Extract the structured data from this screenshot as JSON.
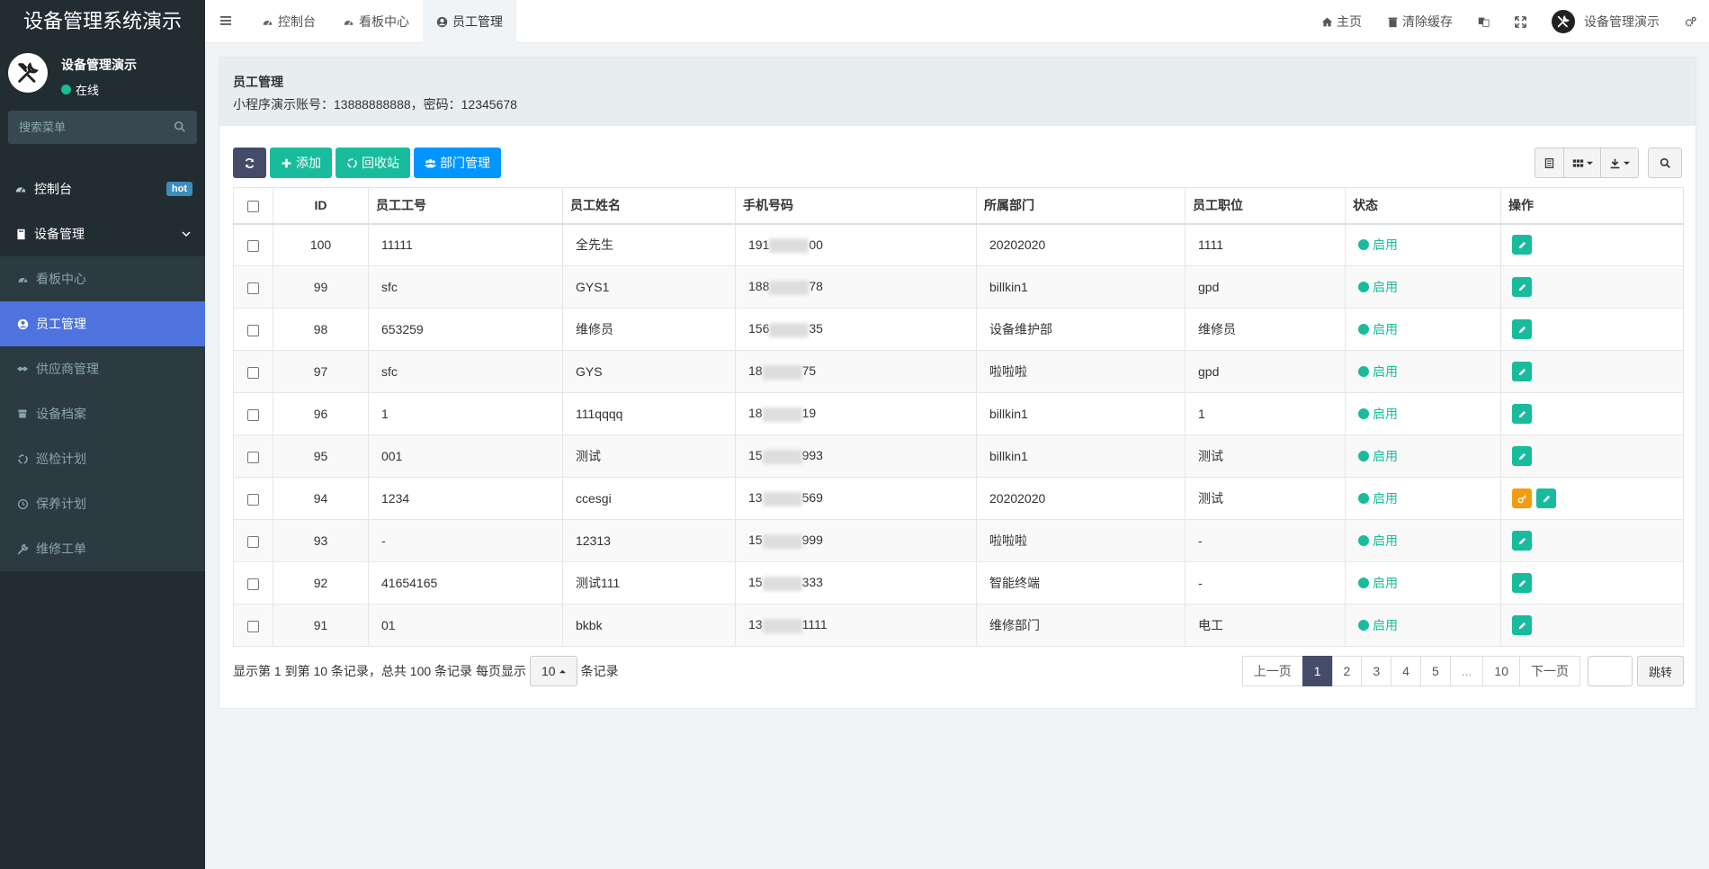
{
  "app": {
    "brand": "设备管理系统演示"
  },
  "user": {
    "name": "设备管理演示",
    "status": "在线"
  },
  "sidebar": {
    "search_placeholder": "搜索菜单",
    "items": [
      {
        "label": "控制台",
        "badge": "hot",
        "icon": "dashboard-icon"
      },
      {
        "label": "设备管理",
        "icon": "book-icon"
      },
      {
        "label": "看板中心",
        "icon": "dashboard-icon"
      },
      {
        "label": "员工管理",
        "icon": "user-circle-icon"
      },
      {
        "label": "供应商管理",
        "icon": "handshake-icon"
      },
      {
        "label": "设备档案",
        "icon": "archive-icon"
      },
      {
        "label": "巡检计划",
        "icon": "recycle-icon"
      },
      {
        "label": "保养计划",
        "icon": "clock-icon"
      },
      {
        "label": "维修工单",
        "icon": "wrench-icon"
      }
    ]
  },
  "navbar": {
    "tabs": [
      {
        "label": "控制台"
      },
      {
        "label": "看板中心"
      },
      {
        "label": "员工管理"
      }
    ],
    "home": "主页",
    "clear_cache": "清除缓存",
    "user": "设备管理演示"
  },
  "panel": {
    "title": "员工管理",
    "desc": "小程序演示账号：13888888888，密码：12345678"
  },
  "toolbar": {
    "add": "添加",
    "recycle": "回收站",
    "dept": "部门管理"
  },
  "table": {
    "headers": [
      "ID",
      "员工工号",
      "员工姓名",
      "手机号码",
      "所属部门",
      "员工职位",
      "状态",
      "操作"
    ],
    "rows": [
      {
        "id": "100",
        "no": "11111",
        "name": "全先生",
        "phone": "191",
        "phone_end": "00",
        "dept": "20202020",
        "pos": "1111",
        "status": "启用"
      },
      {
        "id": "99",
        "no": "sfc",
        "name": "GYS1",
        "phone": "188",
        "phone_end": "78",
        "dept": "billkin1",
        "pos": "gpd",
        "status": "启用"
      },
      {
        "id": "98",
        "no": "653259",
        "name": "维修员",
        "phone": "156",
        "phone_end": "35",
        "dept": "设备维护部",
        "pos": "维修员",
        "status": "启用"
      },
      {
        "id": "97",
        "no": "sfc",
        "name": "GYS",
        "phone": "18",
        "phone_end": "75",
        "dept": "啦啦啦",
        "pos": "gpd",
        "status": "启用"
      },
      {
        "id": "96",
        "no": "1",
        "name": "111qqqq",
        "phone": "18",
        "phone_end": "19",
        "dept": "billkin1",
        "pos": "1",
        "status": "启用"
      },
      {
        "id": "95",
        "no": "001",
        "name": "测试",
        "phone": "15",
        "phone_end": "993",
        "dept": "billkin1",
        "pos": "测试",
        "status": "启用"
      },
      {
        "id": "94",
        "no": "1234",
        "name": "ccesgi",
        "phone": "13",
        "phone_end": "569",
        "dept": "20202020",
        "pos": "测试",
        "status": "启用"
      },
      {
        "id": "93",
        "no": "-",
        "name": "12313",
        "phone": "15",
        "phone_end": "999",
        "dept": "啦啦啦",
        "pos": "-",
        "status": "启用"
      },
      {
        "id": "92",
        "no": "41654165",
        "name": "测试111",
        "phone": "15",
        "phone_end": "333",
        "dept": "智能终端",
        "pos": "-",
        "status": "启用"
      },
      {
        "id": "91",
        "no": "01",
        "name": "bkbk",
        "phone": "13",
        "phone_end": "1111",
        "dept": "维修部门",
        "pos": "电工",
        "status": "启用"
      }
    ]
  },
  "pagination": {
    "info_prefix": "显示第 1 到第 10 条记录，总共 100 条记录 每页显示",
    "page_size": "10",
    "info_suffix": "条记录",
    "prev": "上一页",
    "pages": [
      "1",
      "2",
      "3",
      "4",
      "5",
      "...",
      "10"
    ],
    "next": "下一页",
    "go": "跳转"
  },
  "colors": {
    "sidebar_bg": "#222d32",
    "accent": "#4e73df",
    "success": "#18bc9c",
    "blue": "#0095ff",
    "dark_btn": "#444c69",
    "warn": "#f39c12"
  }
}
